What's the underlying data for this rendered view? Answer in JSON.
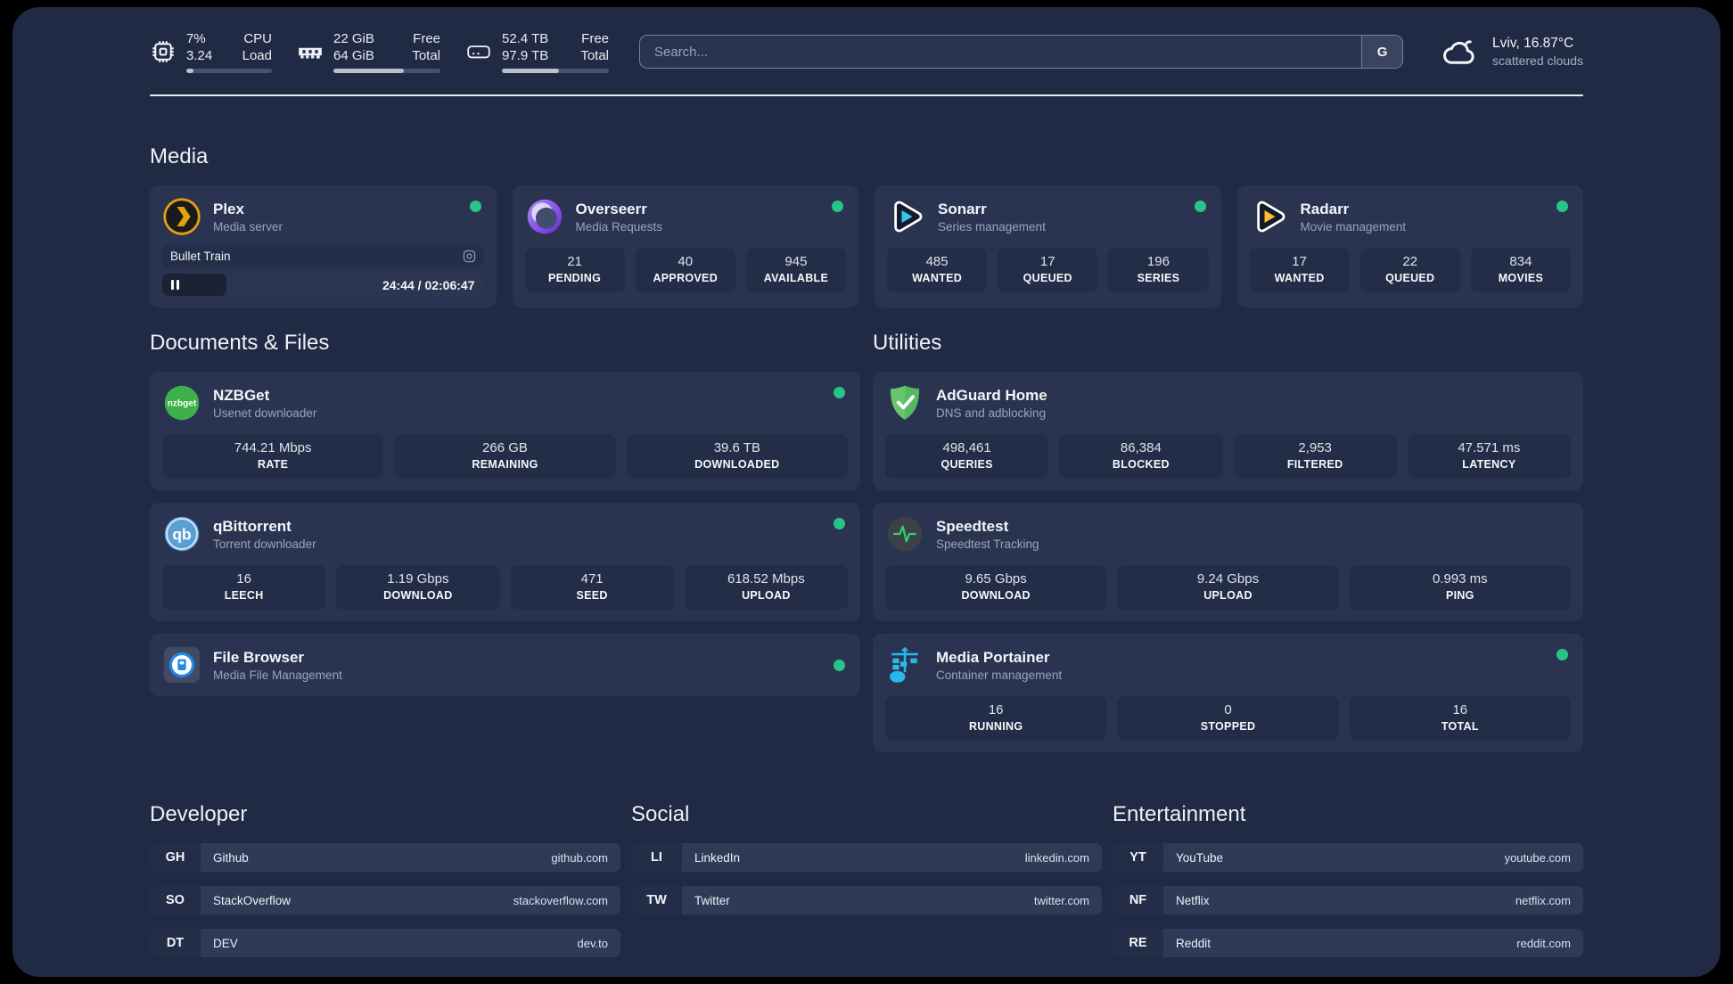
{
  "header": {
    "cpu": {
      "value_top": "7%",
      "value_bottom": "3.24",
      "label_top": "CPU",
      "label_bottom": "Load",
      "progress": 8
    },
    "memory": {
      "value_top": "22 GiB",
      "value_bottom": "64 GiB",
      "label_top": "Free",
      "label_bottom": "Total",
      "progress": 66
    },
    "disk": {
      "value_top": "52.4 TB",
      "value_bottom": "97.9 TB",
      "label_top": "Free",
      "label_bottom": "Total",
      "progress": 53
    },
    "search": {
      "placeholder": "Search...",
      "engine_button": "G"
    },
    "weather": {
      "location_temp": "Lviv, 16.87°C",
      "condition": "scattered clouds"
    }
  },
  "sections": {
    "media": {
      "title": "Media",
      "apps": [
        {
          "name": "Plex",
          "subtitle": "Media server",
          "online": true,
          "now_playing": {
            "title": "Bullet Train",
            "time": "24:44 / 02:06:47",
            "progress": 20,
            "state": "paused"
          }
        },
        {
          "name": "Overseerr",
          "subtitle": "Media Requests",
          "online": true,
          "stats": [
            {
              "value": "21",
              "label": "PENDING"
            },
            {
              "value": "40",
              "label": "APPROVED"
            },
            {
              "value": "945",
              "label": "AVAILABLE"
            }
          ]
        },
        {
          "name": "Sonarr",
          "subtitle": "Series management",
          "online": true,
          "stats": [
            {
              "value": "485",
              "label": "WANTED"
            },
            {
              "value": "17",
              "label": "QUEUED"
            },
            {
              "value": "196",
              "label": "SERIES"
            }
          ]
        },
        {
          "name": "Radarr",
          "subtitle": "Movie management",
          "online": true,
          "stats": [
            {
              "value": "17",
              "label": "WANTED"
            },
            {
              "value": "22",
              "label": "QUEUED"
            },
            {
              "value": "834",
              "label": "MOVIES"
            }
          ]
        }
      ]
    },
    "documents": {
      "title": "Documents & Files",
      "apps": [
        {
          "name": "NZBGet",
          "subtitle": "Usenet downloader",
          "online": true,
          "stats": [
            {
              "value": "744.21 Mbps",
              "label": "RATE"
            },
            {
              "value": "266 GB",
              "label": "REMAINING"
            },
            {
              "value": "39.6 TB",
              "label": "DOWNLOADED"
            }
          ]
        },
        {
          "name": "qBittorrent",
          "subtitle": "Torrent downloader",
          "online": true,
          "stats": [
            {
              "value": "16",
              "label": "LEECH"
            },
            {
              "value": "1.19 Gbps",
              "label": "DOWNLOAD"
            },
            {
              "value": "471",
              "label": "SEED"
            },
            {
              "value": "618.52 Mbps",
              "label": "UPLOAD"
            }
          ]
        },
        {
          "name": "File Browser",
          "subtitle": "Media File Management",
          "online": true,
          "stats": []
        }
      ]
    },
    "utilities": {
      "title": "Utilities",
      "apps": [
        {
          "name": "AdGuard Home",
          "subtitle": "DNS and adblocking",
          "online": false,
          "stats": [
            {
              "value": "498,461",
              "label": "QUERIES"
            },
            {
              "value": "86,384",
              "label": "BLOCKED"
            },
            {
              "value": "2,953",
              "label": "FILTERED"
            },
            {
              "value": "47.571 ms",
              "label": "LATENCY"
            }
          ]
        },
        {
          "name": "Speedtest",
          "subtitle": "Speedtest Tracking",
          "online": false,
          "stats": [
            {
              "value": "9.65 Gbps",
              "label": "DOWNLOAD"
            },
            {
              "value": "9.24 Gbps",
              "label": "UPLOAD"
            },
            {
              "value": "0.993 ms",
              "label": "PING"
            }
          ]
        },
        {
          "name": "Media Portainer",
          "subtitle": "Container management",
          "online": true,
          "stats": [
            {
              "value": "16",
              "label": "RUNNING"
            },
            {
              "value": "0",
              "label": "STOPPED"
            },
            {
              "value": "16",
              "label": "TOTAL"
            }
          ]
        }
      ]
    },
    "developer": {
      "title": "Developer",
      "links": [
        {
          "abbr": "GH",
          "name": "Github",
          "url": "github.com"
        },
        {
          "abbr": "SO",
          "name": "StackOverflow",
          "url": "stackoverflow.com"
        },
        {
          "abbr": "DT",
          "name": "DEV",
          "url": "dev.to"
        }
      ]
    },
    "social": {
      "title": "Social",
      "links": [
        {
          "abbr": "LI",
          "name": "LinkedIn",
          "url": "linkedin.com"
        },
        {
          "abbr": "TW",
          "name": "Twitter",
          "url": "twitter.com"
        }
      ]
    },
    "entertainment": {
      "title": "Entertainment",
      "links": [
        {
          "abbr": "YT",
          "name": "YouTube",
          "url": "youtube.com"
        },
        {
          "abbr": "NF",
          "name": "Netflix",
          "url": "netflix.com"
        },
        {
          "abbr": "RE",
          "name": "Reddit",
          "url": "reddit.com"
        }
      ]
    }
  },
  "colors": {
    "status_online": "#27c585",
    "plex": "#e5a00d",
    "sonarr": "#35c5f4",
    "radarr": "#ffb937",
    "nzbget": "#3db04b",
    "adguard": "#5fcb6b",
    "qbittorrent": "#5a9fd4",
    "filebrowser": "#2086e8",
    "speedtest_pulse": "#2dd36f",
    "portainer": "#29b8eb"
  }
}
